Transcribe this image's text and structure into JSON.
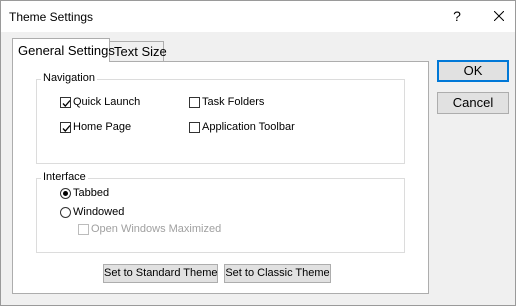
{
  "window": {
    "title": "Theme Settings",
    "help_label": "?",
    "close_icon": "close-icon"
  },
  "tabs": [
    {
      "label": "General Settings",
      "selected": true
    },
    {
      "label": "Text Size",
      "selected": false
    }
  ],
  "navigation": {
    "label": "Navigation",
    "options": [
      {
        "label": "Quick Launch",
        "checked": true,
        "enabled": true
      },
      {
        "label": "Task Folders",
        "checked": false,
        "enabled": true
      },
      {
        "label": "Home Page",
        "checked": true,
        "enabled": true
      },
      {
        "label": "Application Toolbar",
        "checked": false,
        "enabled": true
      }
    ]
  },
  "interface": {
    "label": "Interface",
    "options": [
      {
        "label": "Tabbed",
        "selected": true
      },
      {
        "label": "Windowed",
        "selected": false
      }
    ],
    "open_maximized": {
      "label": "Open Windows Maximized",
      "checked": false,
      "enabled": false
    }
  },
  "buttons": {
    "standard_theme": "Set to Standard Theme",
    "classic_theme": "Set to Classic Theme",
    "ok": "OK",
    "cancel": "Cancel"
  },
  "colors": {
    "accent": "#0078d7",
    "dialog_bg": "#f0f0f0",
    "panel_bg": "#ffffff",
    "disabled_text": "#a0a0a0"
  }
}
